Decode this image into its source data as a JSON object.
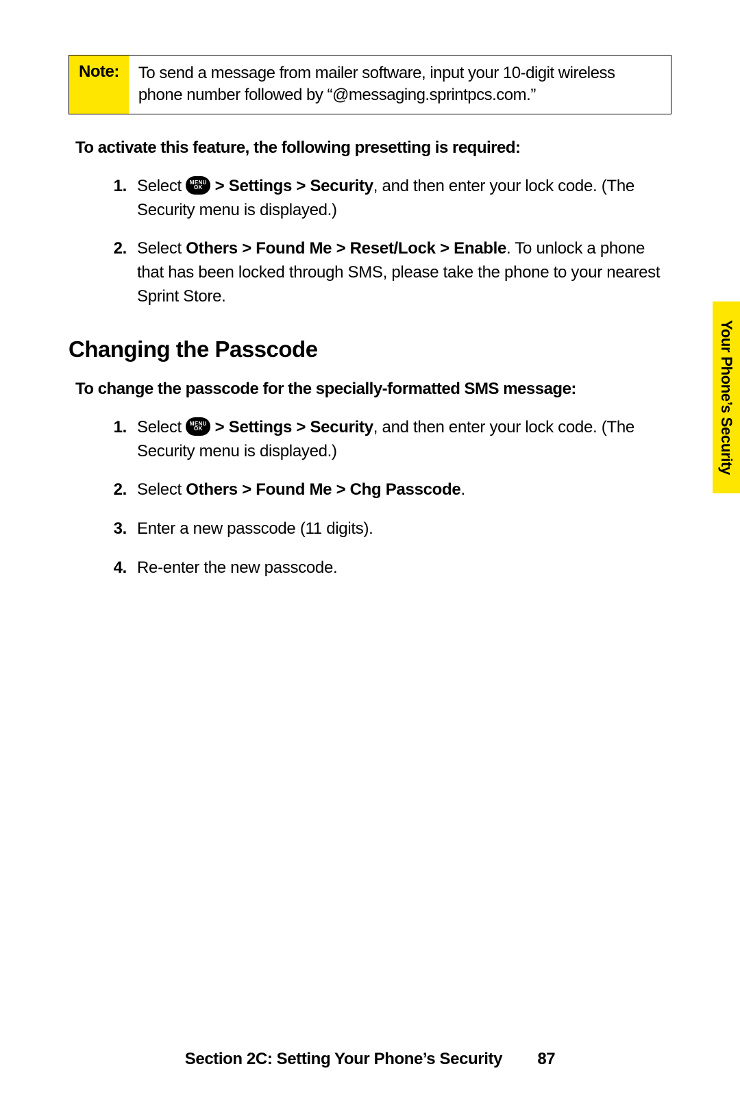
{
  "note": {
    "label": "Note:",
    "text": "To send a message from mailer software, input your 10-digit wireless phone number followed by “@messaging.sprintpcs.com.”"
  },
  "intro1": "To activate this feature, the following presetting is required:",
  "steps1": [
    {
      "num": "1.",
      "pre": "Select ",
      "icon_top": "MENU",
      "icon_bot": "OK",
      "bold_path": " > Settings > Security",
      "post": ", and then enter your lock code. (The Security menu is displayed.)"
    },
    {
      "num": "2.",
      "pre": "Select ",
      "bold_path": "Others > Found Me > Reset/Lock > Enable",
      "post": ". To unlock a phone that has been locked through SMS, please take the phone to your nearest Sprint Store."
    }
  ],
  "heading": "Changing the Passcode",
  "intro2": "To change the passcode for the specially-formatted SMS message:",
  "steps2": [
    {
      "num": "1.",
      "pre": "Select ",
      "icon_top": "MENU",
      "icon_bot": "OK",
      "bold_path": " > Settings > Security",
      "post": ", and then enter your lock code. (The Security menu is displayed.)"
    },
    {
      "num": "2.",
      "pre": "Select ",
      "bold_path": "Others > Found Me > Chg Passcode",
      "post": "."
    },
    {
      "num": "3.",
      "plain": "Enter a new passcode (11 digits)."
    },
    {
      "num": "4.",
      "plain": "Re-enter the new passcode."
    }
  ],
  "side_tab": "Your Phone’s Security",
  "footer": {
    "section": "Section 2C: Setting Your Phone’s Security",
    "page": "87"
  }
}
